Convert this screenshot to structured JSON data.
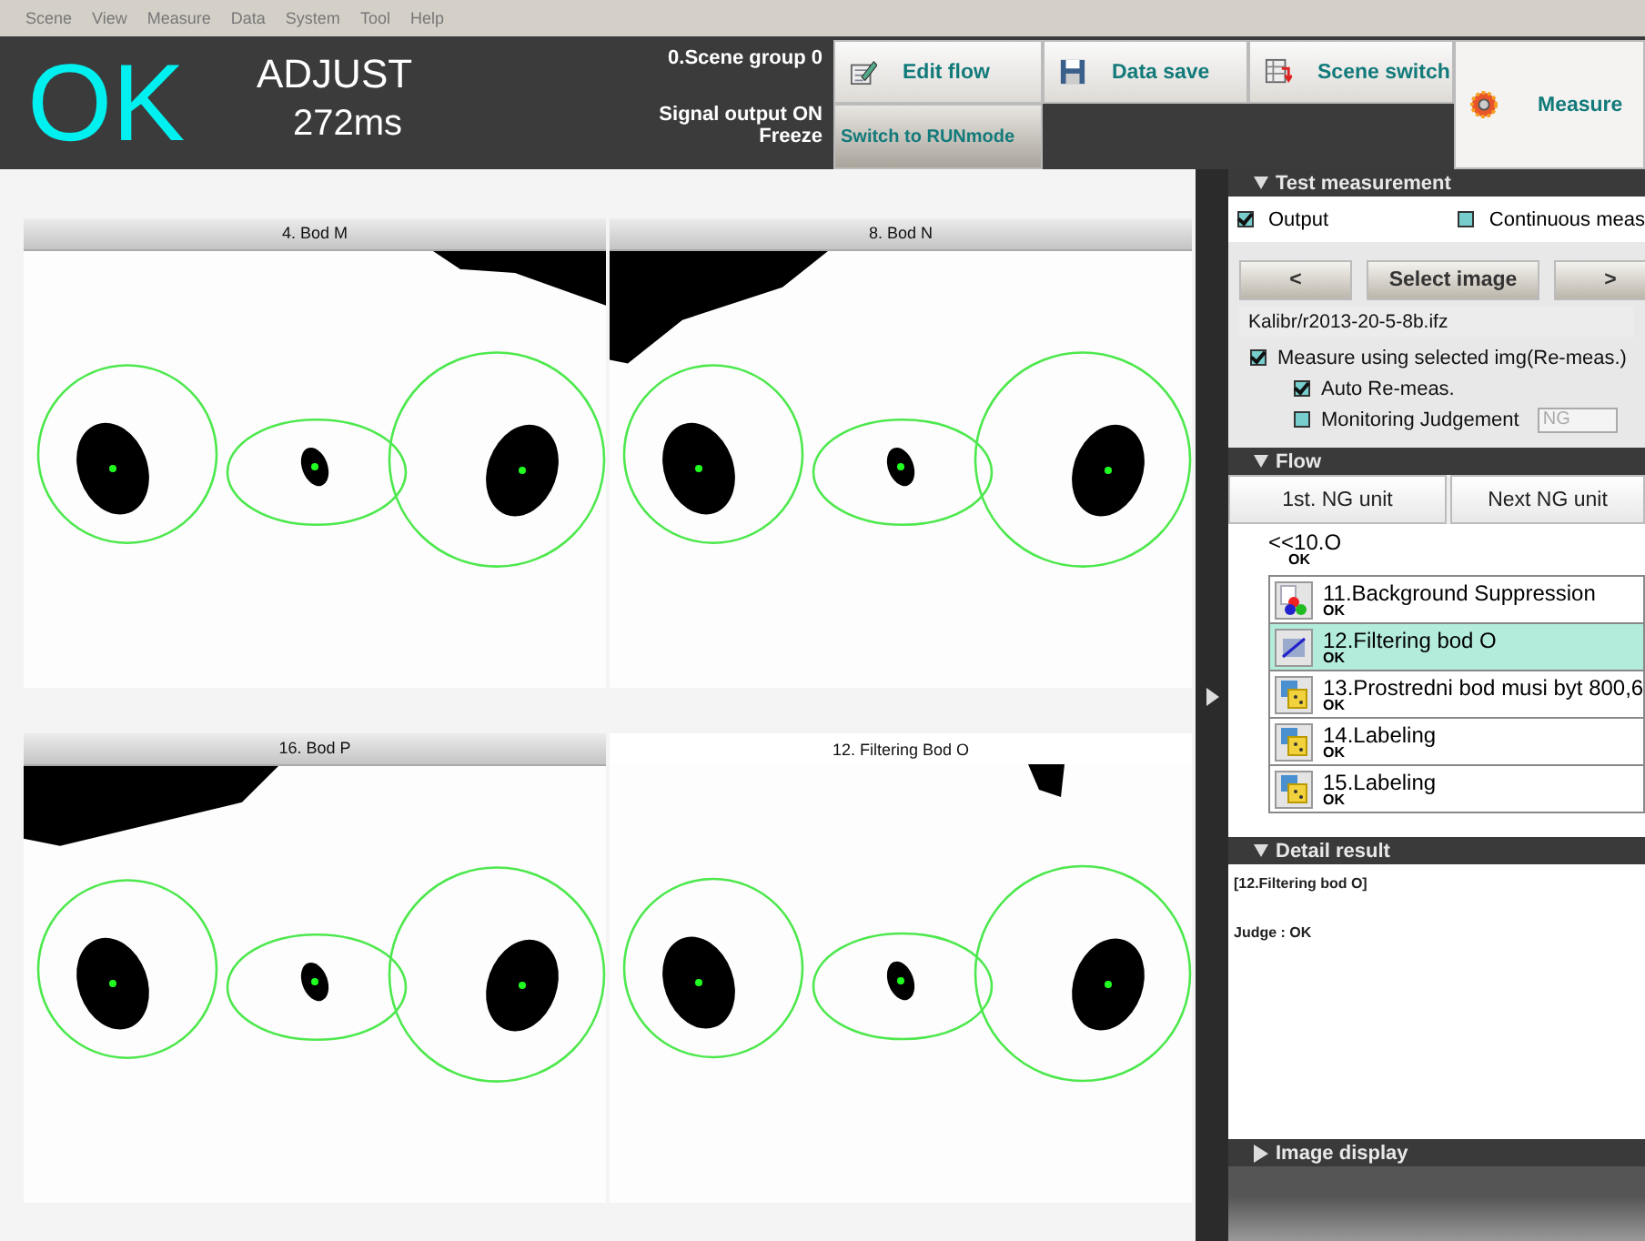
{
  "menu": [
    "Scene",
    "View",
    "Measure",
    "Data",
    "System",
    "Tool",
    "Help"
  ],
  "status": {
    "judgement": "OK",
    "mode": "ADJUST",
    "time": "272ms",
    "scene_group": "0.Scene group 0",
    "signal": "Signal output ON",
    "freeze": "Freeze"
  },
  "toolbar": [
    {
      "label": "Edit flow",
      "kind": "edit"
    },
    {
      "label": "Switch to RUNmode",
      "kind": "text"
    },
    {
      "label": "Data save",
      "kind": "save"
    },
    {
      "label": "Scene switch",
      "kind": "scene"
    },
    {
      "label": "Measure",
      "kind": "measure"
    }
  ],
  "image_panels": [
    {
      "title": "4. Bod M",
      "selected": false
    },
    {
      "title": "8. Bod N",
      "selected": false
    },
    {
      "title": "16. Bod P",
      "selected": false
    },
    {
      "title": "12. Filtering Bod O",
      "selected": true
    }
  ],
  "test_measurement": {
    "title": "Test measurement",
    "expanded": true,
    "output": {
      "label": "Output",
      "checked": true
    },
    "continuous": {
      "label": "Continuous meas",
      "checked": false
    },
    "buttons": [
      "<",
      "Select image",
      ">"
    ],
    "file": "Kalibr/r2013-20-5-8b.ifz",
    "options": [
      {
        "label": "Measure using selected img(Re-meas.)",
        "checked": true
      },
      {
        "label": "Auto Re-meas.",
        "checked": true
      },
      {
        "label": "Monitoring Judgement",
        "checked": false
      }
    ],
    "judgement_select": {
      "value": "NG",
      "disabled": true
    }
  },
  "flow": {
    "title": "Flow",
    "expanded": true,
    "buttons": [
      "1st. NG unit",
      "Next NG unit"
    ],
    "parent": {
      "label": "<<10.O",
      "result": "OK"
    },
    "items": [
      {
        "label": "11.Background Suppression",
        "result": "OK",
        "kind": "background",
        "selected": false
      },
      {
        "label": "12.Filtering bod O",
        "result": "OK",
        "kind": "filter",
        "selected": true
      },
      {
        "label": "13.Prostredni bod musi byt 800,6",
        "result": "OK",
        "kind": "labeling",
        "selected": false
      },
      {
        "label": "14.Labeling",
        "result": "OK",
        "kind": "labeling",
        "selected": false
      },
      {
        "label": "15.Labeling",
        "result": "OK",
        "kind": "labeling",
        "selected": false
      }
    ]
  },
  "detail_result": {
    "title": "Detail result",
    "expanded": true,
    "lines": [
      "[12.Filtering bod O]",
      "Judge : OK"
    ]
  },
  "image_display": {
    "title": "Image display",
    "expanded": false
  }
}
